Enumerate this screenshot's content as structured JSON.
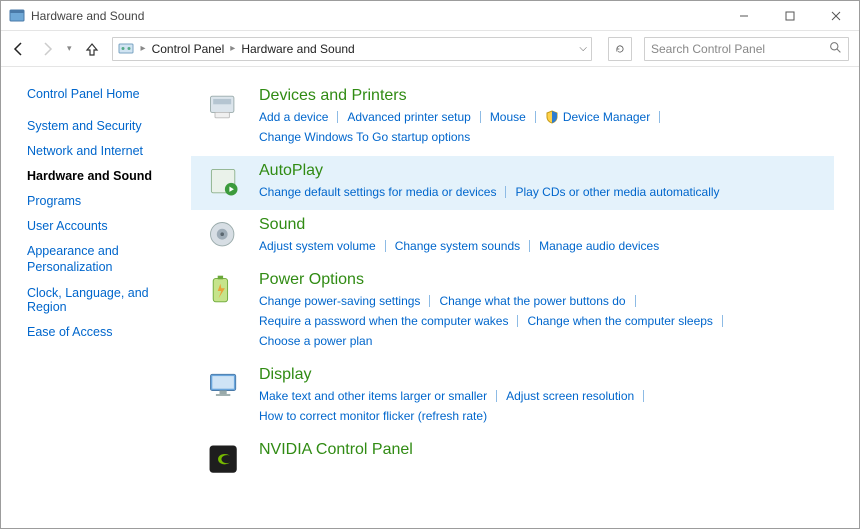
{
  "window": {
    "title": "Hardware and Sound"
  },
  "breadcrumb": {
    "root": "Control Panel",
    "current": "Hardware and Sound"
  },
  "search": {
    "placeholder": "Search Control Panel"
  },
  "sidebar": {
    "home": "Control Panel Home",
    "items": [
      {
        "label": "System and Security"
      },
      {
        "label": "Network and Internet"
      },
      {
        "label": "Hardware and Sound"
      },
      {
        "label": "Programs"
      },
      {
        "label": "User Accounts"
      },
      {
        "label": "Appearance and Personalization"
      },
      {
        "label": "Clock, Language, and Region"
      },
      {
        "label": "Ease of Access"
      }
    ]
  },
  "categories": [
    {
      "name": "devices-and-printers",
      "title": "Devices and Printers",
      "links": [
        "Add a device",
        "Advanced printer setup",
        "Mouse",
        "Device Manager",
        "|",
        "Change Windows To Go startup options"
      ]
    },
    {
      "name": "autoplay",
      "title": "AutoPlay",
      "links": [
        "Change default settings for media or devices",
        "Play CDs or other media automatically"
      ]
    },
    {
      "name": "sound",
      "title": "Sound",
      "links": [
        "Adjust system volume",
        "Change system sounds",
        "Manage audio devices"
      ]
    },
    {
      "name": "power-options",
      "title": "Power Options",
      "links": [
        "Change power-saving settings",
        "Change what the power buttons do",
        "|",
        "Require a password when the computer wakes",
        "Change when the computer sleeps",
        "Choose a power plan"
      ]
    },
    {
      "name": "display",
      "title": "Display",
      "links": [
        "Make text and other items larger or smaller",
        "Adjust screen resolution",
        "|",
        "How to correct monitor flicker (refresh rate)"
      ]
    },
    {
      "name": "nvidia-control-panel",
      "title": "NVIDIA Control Panel",
      "links": []
    }
  ]
}
